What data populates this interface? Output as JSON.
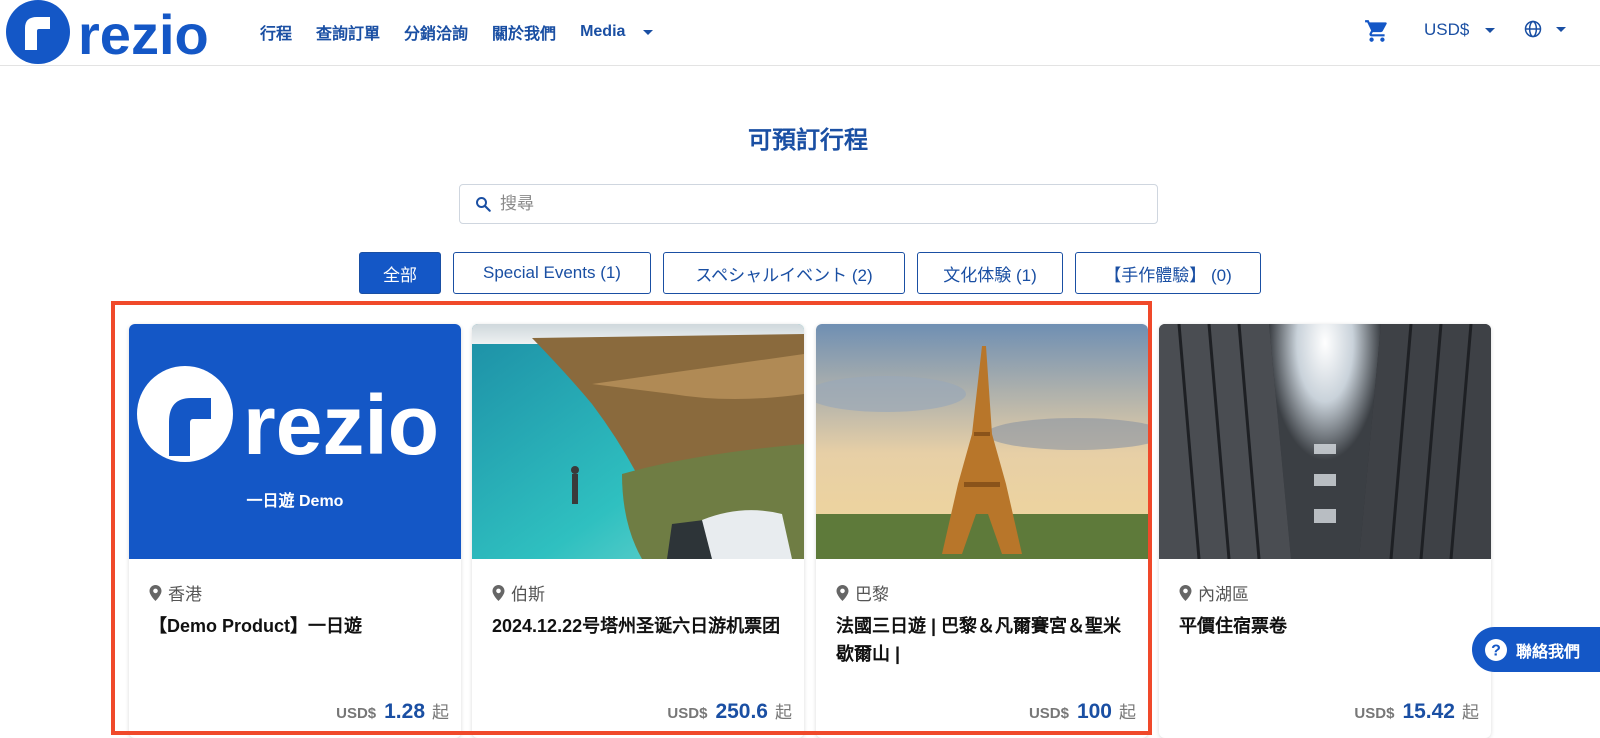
{
  "header": {
    "brand": "rezio",
    "nav": [
      "行程",
      "查詢訂單",
      "分銷洽詢",
      "關於我們",
      "Media"
    ],
    "currency": "USD$"
  },
  "main": {
    "title": "可預訂行程",
    "search_placeholder": "搜尋",
    "tabs": [
      "全部",
      "Special Events (1)",
      "スペシャルイベント (2)",
      "文化体験 (1)",
      "【手作體驗】 (0)"
    ],
    "active_tab": "全部"
  },
  "cards": [
    {
      "image_caption": "一日遊 Demo",
      "location": "香港",
      "title": "【Demo Product】一日遊",
      "currency": "USD$",
      "price": "1.28",
      "suffix": "起"
    },
    {
      "location": "伯斯",
      "title": "2024.12.22号塔州圣诞六日游机票团",
      "currency": "USD$",
      "price": "250.6",
      "suffix": "起"
    },
    {
      "location": "巴黎",
      "title": "法國三日遊 | 巴黎＆凡爾賽宮＆聖米歇爾山 |",
      "currency": "USD$",
      "price": "100",
      "suffix": "起"
    },
    {
      "location": "內湖區",
      "title": "平價住宿票卷",
      "currency": "USD$",
      "price": "15.42",
      "suffix": "起"
    }
  ],
  "contact": {
    "label": "聯絡我們"
  },
  "colors": {
    "brand": "#1457c6",
    "nav_text": "#1a4fa3",
    "highlight": "#f0492a"
  }
}
